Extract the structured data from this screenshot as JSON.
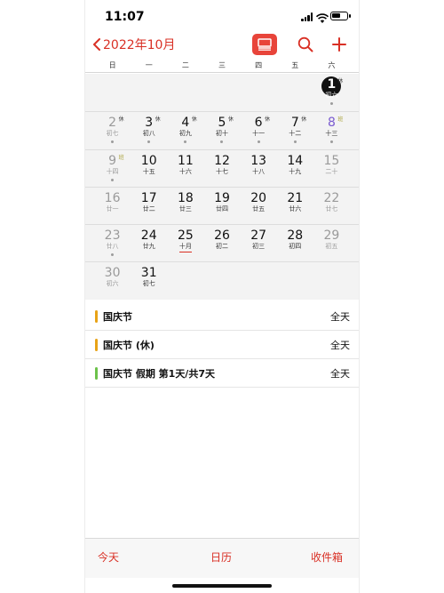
{
  "status": {
    "time": "11:07"
  },
  "nav": {
    "back_label": "2022年10月"
  },
  "weekdays": [
    "日",
    "一",
    "二",
    "三",
    "四",
    "五",
    "六"
  ],
  "colors": {
    "accent": "#d93025",
    "holiday_orange": "#e8a317",
    "holiday_green": "#6cc24a",
    "today_bg": "#111111"
  },
  "weeks": [
    [
      null,
      null,
      null,
      null,
      null,
      null,
      {
        "num": "1",
        "lunar": "初六",
        "tag": "休",
        "today": true,
        "dot": true
      }
    ],
    [
      {
        "num": "2",
        "lunar": "初七",
        "tag": "休",
        "gray": true,
        "dot": true
      },
      {
        "num": "3",
        "lunar": "初八",
        "tag": "休",
        "dot": true
      },
      {
        "num": "4",
        "lunar": "初九",
        "tag": "休",
        "dot": true
      },
      {
        "num": "5",
        "lunar": "初十",
        "tag": "休",
        "dot": true
      },
      {
        "num": "6",
        "lunar": "十一",
        "tag": "休",
        "dot": true
      },
      {
        "num": "7",
        "lunar": "十二",
        "tag": "休",
        "dot": true
      },
      {
        "num": "8",
        "lunar": "十三",
        "tag": "班",
        "purple": true,
        "dot": true
      }
    ],
    [
      {
        "num": "9",
        "lunar": "十四",
        "tag": "班",
        "gray": true,
        "dot": true
      },
      {
        "num": "10",
        "lunar": "十五"
      },
      {
        "num": "11",
        "lunar": "十六"
      },
      {
        "num": "12",
        "lunar": "十七"
      },
      {
        "num": "13",
        "lunar": "十八"
      },
      {
        "num": "14",
        "lunar": "十九"
      },
      {
        "num": "15",
        "lunar": "二十",
        "gray": true
      }
    ],
    [
      {
        "num": "16",
        "lunar": "廿一",
        "gray": true
      },
      {
        "num": "17",
        "lunar": "廿二"
      },
      {
        "num": "18",
        "lunar": "廿三"
      },
      {
        "num": "19",
        "lunar": "廿四"
      },
      {
        "num": "20",
        "lunar": "廿五"
      },
      {
        "num": "21",
        "lunar": "廿六"
      },
      {
        "num": "22",
        "lunar": "廿七",
        "gray": true
      }
    ],
    [
      {
        "num": "23",
        "lunar": "廿八",
        "gray": true,
        "dot": true
      },
      {
        "num": "24",
        "lunar": "廿九"
      },
      {
        "num": "25",
        "lunar": "十月",
        "underline": true
      },
      {
        "num": "26",
        "lunar": "初二"
      },
      {
        "num": "27",
        "lunar": "初三"
      },
      {
        "num": "28",
        "lunar": "初四"
      },
      {
        "num": "29",
        "lunar": "初五",
        "gray": true
      }
    ],
    [
      {
        "num": "30",
        "lunar": "初六",
        "gray": true
      },
      {
        "num": "31",
        "lunar": "初七"
      },
      null,
      null,
      null,
      null,
      null
    ]
  ],
  "events": [
    {
      "title": "国庆节",
      "time": "全天",
      "color": "#e8a317"
    },
    {
      "title": "国庆节 (休)",
      "time": "全天",
      "color": "#e8a317"
    },
    {
      "title": "国庆节 假期 第1天/共7天",
      "time": "全天",
      "color": "#6cc24a"
    }
  ],
  "tabs": {
    "today": "今天",
    "calendars": "日历",
    "inbox": "收件箱"
  }
}
